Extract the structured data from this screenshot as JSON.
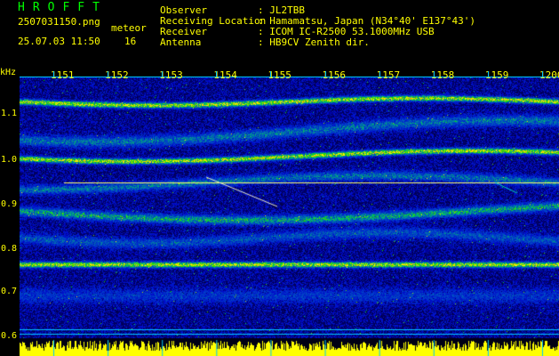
{
  "app": {
    "logo": "HROFFT",
    "filename": "2507031150.png",
    "timestamp": "25.07.03 11:50",
    "mode_label": "meteor",
    "count": "16"
  },
  "station": {
    "observer_label": "Observer",
    "observer_value": ": JL2TBB",
    "location_label": "Receiving Location",
    "location_value": ": Hamamatsu, Japan (N34°40' E137°43')",
    "receiver_label": "Receiver",
    "receiver_value": ": ICOM IC-R2500 53.1000MHz USB",
    "antenna_label": "Antenna",
    "antenna_value": ": HB9CV Zenith dir."
  },
  "axis": {
    "unit": "kHz",
    "time_ticks": [
      "1151",
      "1152",
      "1153",
      "1154",
      "1155",
      "1156",
      "1157",
      "1158",
      "1159",
      "1200"
    ],
    "freq_ticks": [
      "1.1",
      "1.0",
      "0.9",
      "0.8",
      "0.7",
      "0.6"
    ]
  },
  "colors": {
    "text": "#ffff00",
    "logo": "#00ff00",
    "ruler": "#00c8ff",
    "background": "#000000"
  }
}
